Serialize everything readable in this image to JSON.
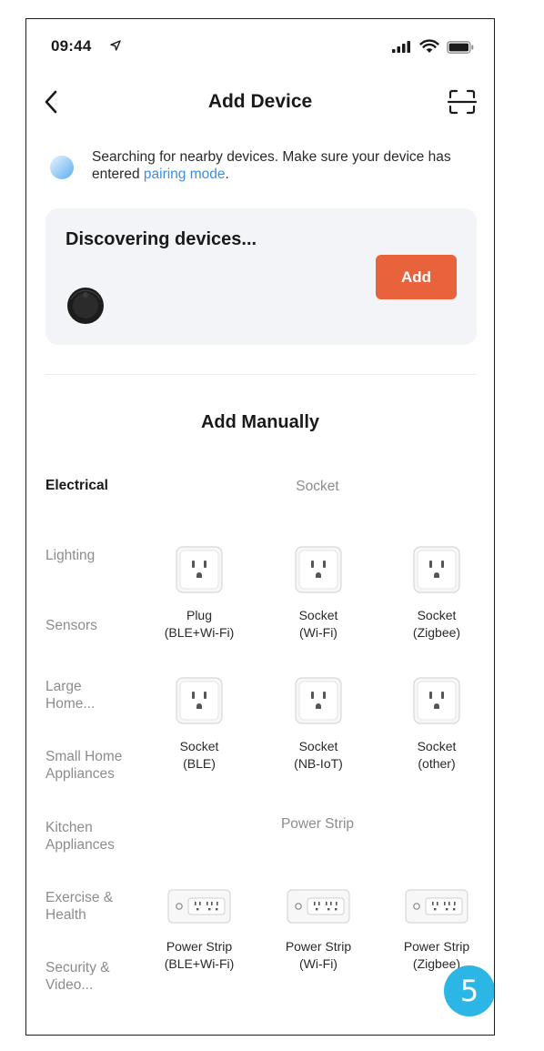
{
  "status_bar": {
    "time": "09:44"
  },
  "nav": {
    "title": "Add Device"
  },
  "notice": {
    "text_before": "Searching for nearby devices. Make sure your device has entered ",
    "link": "pairing mode",
    "text_after": "."
  },
  "discover": {
    "title": "Discovering devices...",
    "add_label": "Add"
  },
  "manual": {
    "title": "Add Manually"
  },
  "categories": [
    {
      "label": "Electrical"
    },
    {
      "label": "Lighting"
    },
    {
      "label": "Sensors"
    },
    {
      "label": "Large Home..."
    },
    {
      "label": "Small Home Appliances"
    },
    {
      "label": "Kitchen Appliances"
    },
    {
      "label": "Exercise & Health"
    },
    {
      "label": "Security & Video..."
    }
  ],
  "groups": {
    "socket": {
      "title": "Socket",
      "items": [
        {
          "line1": "Plug",
          "line2": "(BLE+Wi-Fi)"
        },
        {
          "line1": "Socket",
          "line2": "(Wi-Fi)"
        },
        {
          "line1": "Socket",
          "line2": "(Zigbee)"
        },
        {
          "line1": "Socket",
          "line2": "(BLE)"
        },
        {
          "line1": "Socket",
          "line2": "(NB-IoT)"
        },
        {
          "line1": "Socket",
          "line2": "(other)"
        }
      ]
    },
    "power_strip": {
      "title": "Power Strip",
      "items": [
        {
          "line1": "Power Strip",
          "line2": "(BLE+Wi-Fi)"
        },
        {
          "line1": "Power Strip",
          "line2": "(Wi-Fi)"
        },
        {
          "line1": "Power Strip",
          "line2": "(Zigbee)"
        }
      ]
    }
  },
  "badge": {
    "number": "5"
  },
  "colors": {
    "accent": "#e8633b",
    "link": "#3d8ee5",
    "badge": "#2cb6e6",
    "card_bg": "#f3f4f7"
  }
}
